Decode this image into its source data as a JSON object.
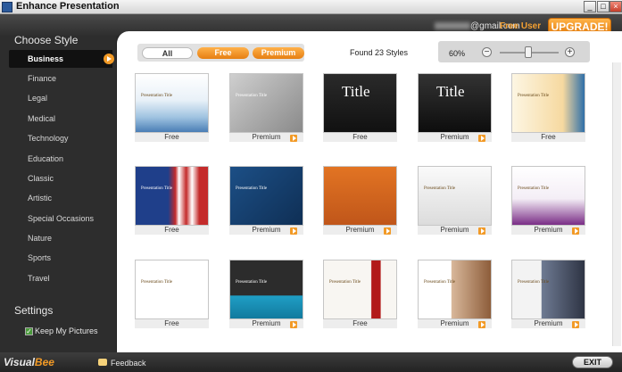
{
  "window": {
    "title": "Enhance Presentation",
    "buttons": [
      "_",
      "□",
      "×"
    ]
  },
  "header": {
    "email": "@gmail.com",
    "user_status": "Free User",
    "upgrade_label": "UPGRADE!"
  },
  "sidebar": {
    "heading": "Choose Style",
    "items": [
      {
        "label": "Business",
        "active": true
      },
      {
        "label": "Finance"
      },
      {
        "label": "Legal"
      },
      {
        "label": "Medical"
      },
      {
        "label": "Technology"
      },
      {
        "label": "Education"
      },
      {
        "label": "Classic"
      },
      {
        "label": "Artistic"
      },
      {
        "label": "Special Occasions"
      },
      {
        "label": "Nature"
      },
      {
        "label": "Sports"
      },
      {
        "label": "Travel"
      }
    ],
    "settings_heading": "Settings",
    "keep_pictures": {
      "label": "Keep My Pictures",
      "checked": true
    }
  },
  "toolbar": {
    "tabs": [
      "All",
      "Free",
      "Premium"
    ],
    "found": "Found 23 Styles",
    "zoom": "60%",
    "zoom_minus": "−",
    "zoom_plus": "+"
  },
  "styles": [
    {
      "label": "Free",
      "premium": false,
      "thumb_title": "Presentation Title",
      "scheme": "light-blue-waves"
    },
    {
      "label": "Premium",
      "premium": true,
      "thumb_title": "Presentation Title",
      "scheme": "dark-card"
    },
    {
      "label": "Free",
      "premium": false,
      "thumb_title": "Title",
      "scheme": "black-title"
    },
    {
      "label": "Premium",
      "premium": true,
      "thumb_title": "Title",
      "scheme": "black-pen"
    },
    {
      "label": "Free",
      "premium": false,
      "thumb_title": "Presentation Title",
      "scheme": "cream-swirl"
    },
    {
      "label": "Free",
      "premium": false,
      "thumb_title": "Presentation Title",
      "scheme": "flag"
    },
    {
      "label": "Premium",
      "premium": true,
      "thumb_title": "Presentation Title",
      "scheme": "blue-gradient"
    },
    {
      "label": "Premium",
      "premium": true,
      "thumb_title": "",
      "scheme": "orange-photo"
    },
    {
      "label": "Premium",
      "premium": true,
      "thumb_title": "Presentation Title",
      "scheme": "building"
    },
    {
      "label": "Premium",
      "premium": true,
      "thumb_title": "Presentation Title",
      "scheme": "purple-woman"
    },
    {
      "label": "Free",
      "premium": false,
      "thumb_title": "Presentation Title",
      "scheme": "people-www"
    },
    {
      "label": "Premium",
      "premium": true,
      "thumb_title": "Presentation Title",
      "scheme": "dark-teal"
    },
    {
      "label": "Free",
      "premium": false,
      "thumb_title": "Presentation Title",
      "scheme": "red-panel"
    },
    {
      "label": "Premium",
      "premium": true,
      "thumb_title": "Presentation Title",
      "scheme": "phone-man"
    },
    {
      "label": "Premium",
      "premium": true,
      "thumb_title": "Presentation Title",
      "scheme": "business-man"
    }
  ],
  "footer": {
    "logo_a": "Visual",
    "logo_b": "Bee",
    "feedback": "Feedback",
    "exit": "EXIT"
  }
}
